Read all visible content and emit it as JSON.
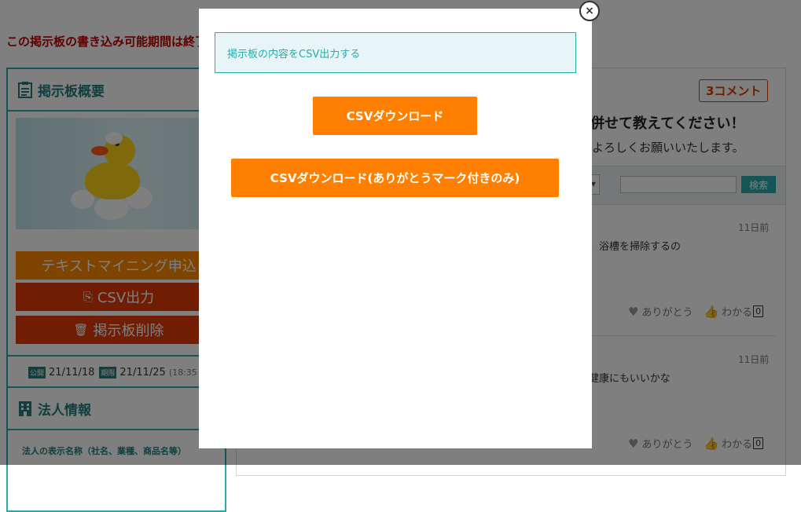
{
  "page": {
    "notice": "この掲示板の書き込み可能期間は終了",
    "sidebar": {
      "overview_title": "掲示板概要",
      "buttons": {
        "text_mining": "テキストマイニング申込",
        "csv_export": "CSV出力",
        "delete": "掲示板削除"
      },
      "dates": {
        "published_tag": "公開",
        "published_date": "21/11/18",
        "deadline_tag": "期限",
        "deadline_date": "21/11/25",
        "deadline_time": "(18:35"
      },
      "corp_title": "法人情報",
      "corp_line": "法人の表示名称（社名、業種、商品名等）"
    },
    "main": {
      "comment_count": "3コメント",
      "question_title": "併せて教えてください！",
      "question_sub": "よろしくお願いいたします。",
      "search_button": "検索",
      "posts": [
        {
          "date": "11日前",
          "text": "、浴槽を掃除するの",
          "thanks": "ありがとう",
          "understand": "わかる",
          "count": "0"
        },
        {
          "date": "11日前",
          "text": "健康にもいいかな",
          "thanks": "ありがとう",
          "understand": "わかる",
          "count": "0"
        }
      ]
    }
  },
  "modal": {
    "heading": "掲示板の内容をCSV出力する",
    "csv_download": "CSVダウンロード",
    "csv_download_thanks": "CSVダウンロード(ありがとうマーク付きのみ)",
    "close_icon": "×"
  },
  "colors": {
    "accent_teal": "#2aaaaa",
    "orange_button": "#ff8000",
    "red_button": "#e03b06",
    "notice_red": "#c00000"
  },
  "icons": [
    "clipboard-icon",
    "export-icon",
    "trash-icon",
    "building-icon",
    "heart-icon",
    "thumbs-up-icon",
    "close-icon"
  ]
}
